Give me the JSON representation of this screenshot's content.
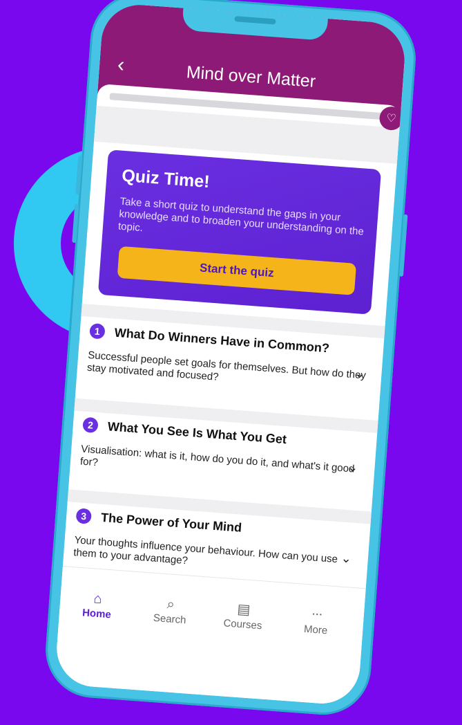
{
  "header": {
    "title": "Mind over Matter"
  },
  "quiz": {
    "title": "Quiz Time!",
    "text": "Take a short quiz to understand the gaps in your knowledge and to broaden your understanding on the topic.",
    "button_label": "Start the quiz"
  },
  "lessons": [
    {
      "number": "1",
      "title": "What Do Winners Have in Common?",
      "desc": "Successful people set goals for themselves. But how do they stay motivated and focused?"
    },
    {
      "number": "2",
      "title": "What You See Is What You Get",
      "desc": "Visualisation: what is it, how do you do it, and what's it good for?"
    },
    {
      "number": "3",
      "title": "The Power of Your Mind",
      "desc": "Your thoughts influence your behaviour. How can you use them to your advantage?"
    }
  ],
  "tabs": [
    {
      "label": "Home",
      "icon": "home-icon"
    },
    {
      "label": "Search",
      "icon": "search-icon"
    },
    {
      "label": "Courses",
      "icon": "book-icon"
    },
    {
      "label": "More",
      "icon": "more-icon"
    }
  ],
  "colors": {
    "background": "#7a08ee",
    "ring": "#31c8f2",
    "phone_frame": "#47c3e6",
    "topbar": "#8e1a77",
    "quiz_card": "#5d21d2",
    "quiz_button": "#f5b51a",
    "active_tab": "#5b1dd8"
  }
}
